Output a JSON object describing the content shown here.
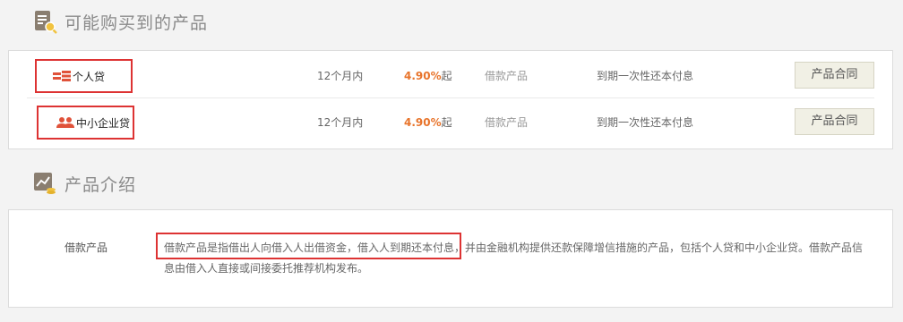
{
  "section1": {
    "title": "可能购买到的产品",
    "icon": "document-search-icon"
  },
  "products": [
    {
      "name": "个人贷",
      "icon": "personal-loan-icon",
      "term": "12个月内",
      "rate": "4.90%",
      "rate_suffix": "起",
      "type": "借款产品",
      "repayment": "到期一次性还本付息",
      "contract_label": "产品合同"
    },
    {
      "name": "中小企业贷",
      "icon": "enterprise-loan-icon",
      "term": "12个月内",
      "rate": "4.90%",
      "rate_suffix": "起",
      "type": "借款产品",
      "repayment": "到期一次性还本付息",
      "contract_label": "产品合同"
    }
  ],
  "section2": {
    "title": "产品介绍",
    "icon": "chart-coins-icon"
  },
  "intro": {
    "label": "借款产品",
    "text": "借款产品是指借出人向借入人出借资金，借入人到期还本付息，并由金融机构提供还款保障增信措施的产品，包括个人贷和中小企业贷。借款产品信息由借入人直接或间接委托推荐机构发布。"
  },
  "colors": {
    "accent_rate": "#e8742b",
    "icon_red": "#e0523a",
    "highlight_border": "#dd3333"
  }
}
